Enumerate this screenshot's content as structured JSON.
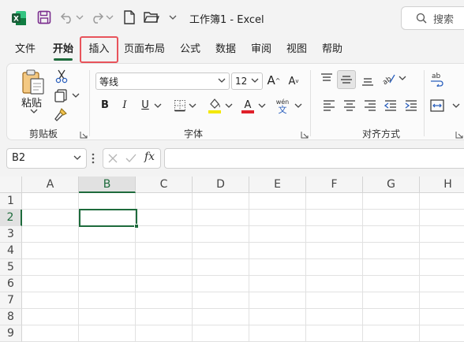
{
  "app": {
    "title": "工作簿1  -  Excel",
    "search_label": "搜索"
  },
  "tabs": [
    {
      "label": "文件"
    },
    {
      "label": "开始"
    },
    {
      "label": "插入"
    },
    {
      "label": "页面布局"
    },
    {
      "label": "公式"
    },
    {
      "label": "数据"
    },
    {
      "label": "审阅"
    },
    {
      "label": "视图"
    },
    {
      "label": "帮助"
    }
  ],
  "ribbon": {
    "clipboard": {
      "paste_label": "粘贴",
      "group_label": "剪贴板"
    },
    "font": {
      "font_name": "等线",
      "font_size": "12",
      "group_label": "字体",
      "bold": "B",
      "italic": "I",
      "underline": "U",
      "fill_color": "#f3e800",
      "font_color": "#e0202a",
      "phonetic_top": "wén",
      "phonetic_bottom": "文"
    },
    "alignment": {
      "group_label": "对齐方式"
    }
  },
  "formula_bar": {
    "name_box": "B2",
    "fx": "fx",
    "content": ""
  },
  "sheet": {
    "columns": [
      "A",
      "B",
      "C",
      "D",
      "E",
      "F",
      "G",
      "H"
    ],
    "rows": [
      "1",
      "2",
      "3",
      "4",
      "5",
      "6",
      "7",
      "8",
      "9"
    ],
    "selected_column": "B",
    "selected_row": "2"
  },
  "colors": {
    "accent": "#1e6b3c",
    "highlight_border": "#e8535b"
  }
}
